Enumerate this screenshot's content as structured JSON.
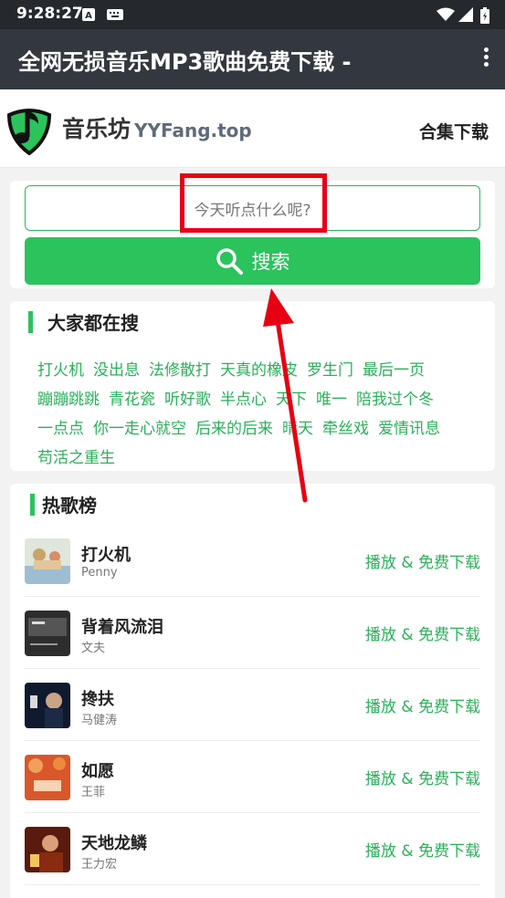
{
  "status_bar": {
    "time": "9:28:27"
  },
  "app_bar": {
    "title": "全网无损音乐MP3歌曲免费下载 -"
  },
  "header": {
    "brand": "音乐坊",
    "domain": "YYFang.top",
    "collection_link": "合集下载"
  },
  "search": {
    "placeholder": "今天听点什么呢?",
    "button_label": "搜索"
  },
  "popular": {
    "title": "大家都在搜",
    "tags": [
      "打火机",
      "没出息",
      "法修散打",
      "天真的橡皮",
      "罗生门",
      "最后一页",
      "蹦蹦跳跳",
      "青花瓷",
      "听好歌",
      "半点心",
      "天下",
      "唯一",
      "陪我过个冬",
      "一点点",
      "你一走心就空",
      "后来的后来",
      "晴天",
      "牵丝戏",
      "爱情讯息",
      "苟活之重生"
    ]
  },
  "chart": {
    "title": "热歌榜",
    "action_label": "播放 & 免费下载",
    "songs": [
      {
        "name": "打火机",
        "artist": "Penny"
      },
      {
        "name": "背着风流泪",
        "artist": "文夫"
      },
      {
        "name": "搀扶",
        "artist": "马健涛"
      },
      {
        "name": "如愿",
        "artist": "王菲"
      },
      {
        "name": "天地龙鳞",
        "artist": "王力宏"
      }
    ]
  },
  "colors": {
    "accent": "#2bc35c",
    "annotation": "#e60012",
    "appbar": "#33383e"
  }
}
